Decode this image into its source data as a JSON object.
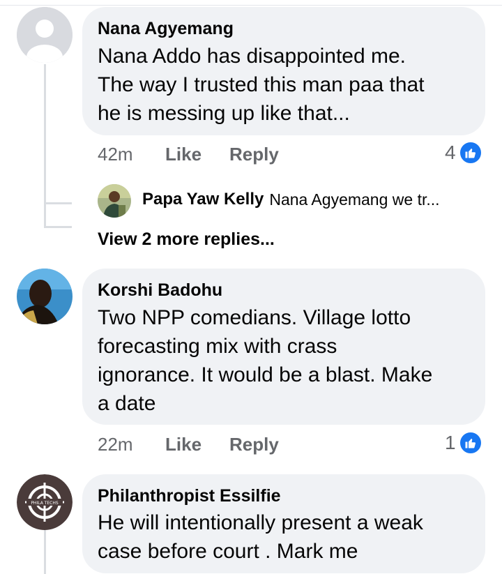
{
  "comments": [
    {
      "author": "Nana Agyemang",
      "text": "Nana Addo has disappointed me.\nThe way I trusted this man paa that\nhe is messing up like that...",
      "time": "42m",
      "like_label": "Like",
      "reply_label": "Reply",
      "reaction_count": "4",
      "reply_preview": {
        "author": "Papa Yaw Kelly",
        "text": "Nana Agyemang we tr..."
      },
      "more_replies": "View 2 more replies..."
    },
    {
      "author": "Korshi Badohu",
      "text": "Two NPP comedians. Village lotto\nforecasting mix with crass\nignorance. It would be a blast. Make\na date",
      "time": "22m",
      "like_label": "Like",
      "reply_label": "Reply",
      "reaction_count": "1"
    },
    {
      "author": "Philanthropist Essilfie",
      "text": "He will intentionally present a weak\ncase before court . Mark me",
      "avatar_logo_text": "PHILA TECHS"
    }
  ],
  "colors": {
    "like_blue": "#1877f2",
    "bubble_bg": "#f0f2f5",
    "meta_gray": "#65676b"
  },
  "icons": {
    "reaction": "thumbs-up-icon"
  }
}
